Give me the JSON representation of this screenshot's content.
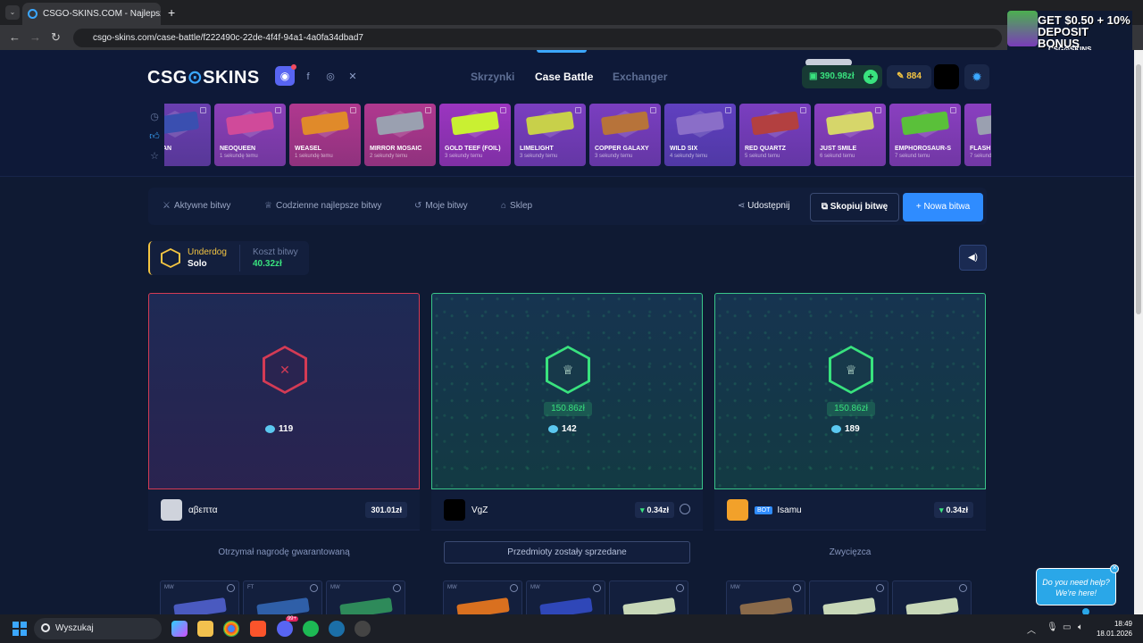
{
  "browser": {
    "tab_title": "CSGO-SKINS.COM - Najlepsze k",
    "url": "csgo-skins.com/case-battle/f222490c-22de-4f4f-94a1-4a0fa34dbad7"
  },
  "promo": {
    "line1": "GET $0.50 + 10%",
    "line2": "DEPOSIT BONUS",
    "brand": "CSG⊙SKINS"
  },
  "header": {
    "logo_left": "CSG",
    "logo_o": "⊙",
    "logo_right": "SKINS",
    "nav": [
      "Skrzynki",
      "Case Battle",
      "Exchanger"
    ],
    "balance": "390.98zł",
    "coins": "884",
    "accent": "#3ba7ff"
  },
  "drops": [
    {
      "name": "NAYMAN",
      "time": "teraz",
      "color": "#6a3fb0",
      "gun": "#3a4fb0",
      "x": true
    },
    {
      "name": "NEOQUEEN",
      "time": "1 sekundę temu",
      "color": "#8b3fb8",
      "gun": "#d04a9a",
      "x": false
    },
    {
      "name": "WEASEL",
      "time": "1 sekundę temu",
      "color": "#b0388f",
      "gun": "#e08a2a",
      "x": false
    },
    {
      "name": "MIRROR MOSAIC",
      "time": "2 sekundy temu",
      "color": "#b0388f",
      "gun": "#9aa0b0",
      "x": false
    },
    {
      "name": "GOLD TEEF (FOIL)",
      "time": "3 sekundy temu",
      "color": "#9b35c0",
      "gun": "#c9f032",
      "x": true
    },
    {
      "name": "LIMELIGHT",
      "time": "3 sekundy temu",
      "color": "#7a3ec0",
      "gun": "#c8d04a",
      "x": false
    },
    {
      "name": "COPPER GALAXY",
      "time": "3 sekundy temu",
      "color": "#7a3ec0",
      "gun": "#b7733a",
      "x": false
    },
    {
      "name": "WILD SIX",
      "time": "4 sekundy temu",
      "color": "#6040c0",
      "gun": "#8a6ec8",
      "x": false
    },
    {
      "name": "RED QUARTZ",
      "time": "5 sekund temu",
      "color": "#7a3ec0",
      "gun": "#b34040",
      "x": false
    },
    {
      "name": "JUST SMILE",
      "time": "6 sekund temu",
      "color": "#8a3fc0",
      "gun": "#d6d66a",
      "x": false
    },
    {
      "name": "EMPHOROSAUR-S",
      "time": "7 sekund temu",
      "color": "#8a3fc0",
      "gun": "#5ac03a",
      "x": true
    },
    {
      "name": "FLASH",
      "time": "7 sekund temu",
      "color": "#8a3fc0",
      "gun": "#9aa0b0",
      "x": false
    }
  ],
  "toolbar": {
    "active": "Aktywne bitwy",
    "daily": "Codzienne najlepsze bitwy",
    "mine": "Moje bitwy",
    "shop": "Sklep",
    "share": "Udostępnij",
    "copy": "Skopiuj bitwę",
    "new": "Nowa bitwa"
  },
  "mode": {
    "name": "Underdog",
    "type": "Solo",
    "cost_label": "Koszt bitwy",
    "cost": "40.32zł"
  },
  "players": [
    {
      "result": "lose",
      "prize": "",
      "gems": "119",
      "name": "αβεπτα",
      "value": "301.01zł",
      "status": "Otrzymał nagrodę gwarantowaną",
      "status_boxed": false,
      "bot": "",
      "value_arrow": "",
      "avatar": "#cfd3dc",
      "items": [
        {
          "wear": "MW",
          "color": "#4a5ac0"
        },
        {
          "wear": "FT",
          "color": "#2f5fa8"
        },
        {
          "wear": "MW",
          "color": "#2e8a5a"
        }
      ]
    },
    {
      "result": "win",
      "prize": "150.86zł",
      "gems": "142",
      "name": "VgZ",
      "value": "0.34zł",
      "status": "Przedmioty zostały sprzedane",
      "status_boxed": true,
      "bot": "",
      "value_arrow": "▾",
      "avatar": "#000000",
      "items": [
        {
          "wear": "MW",
          "color": "#d9701f"
        },
        {
          "wear": "MW",
          "color": "#2f47b8"
        },
        {
          "wear": "",
          "color": "#c8d8b8"
        }
      ]
    },
    {
      "result": "win",
      "prize": "150.86zł",
      "gems": "189",
      "name": "Isamu",
      "value": "0.34zł",
      "status": "Zwycięzca",
      "status_boxed": false,
      "bot": "BOT",
      "value_arrow": "▾",
      "avatar": "#f2a12a",
      "items": [
        {
          "wear": "MW",
          "color": "#8a6a4a"
        },
        {
          "wear": "",
          "color": "#c8d8b8"
        },
        {
          "wear": "",
          "color": "#c8d8b8"
        }
      ]
    }
  ],
  "help": {
    "line1": "Do you need help?",
    "line2": "We're here!"
  },
  "taskbar": {
    "search": "Wyszukaj",
    "time": "18:49",
    "date": "18.01.2026",
    "badge": "99+"
  }
}
